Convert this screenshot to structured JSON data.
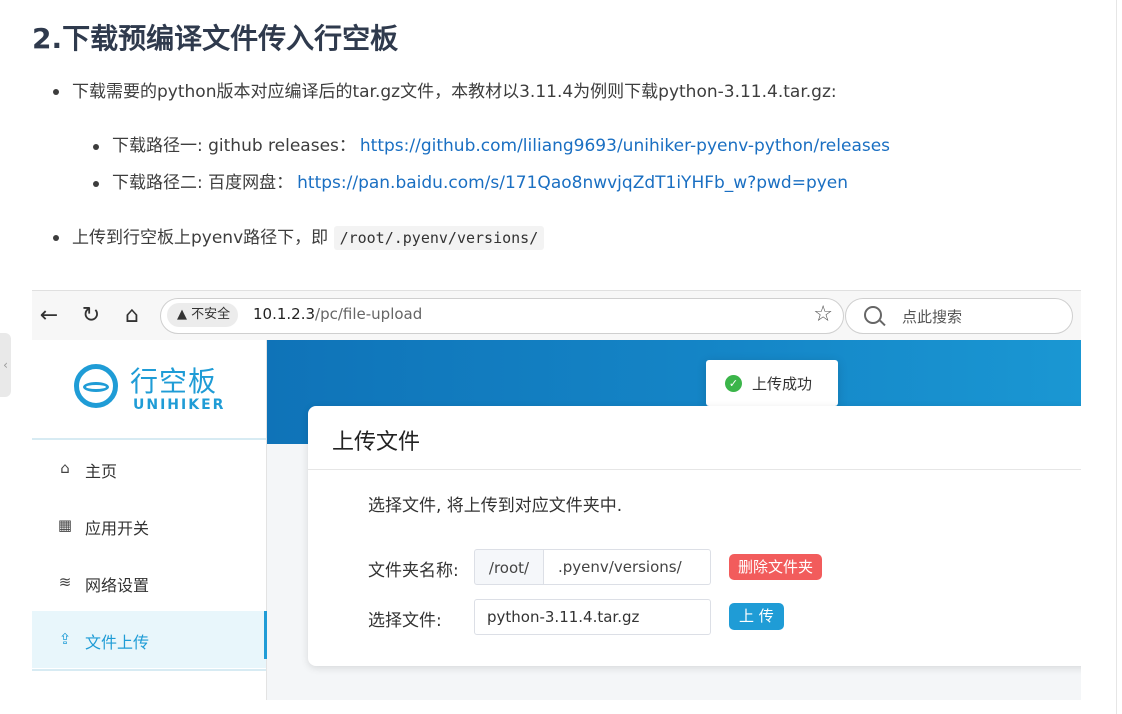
{
  "doc": {
    "title": "2.下载预编译文件传入行空板",
    "bullet1": "下载需要的python版本对应编译后的tar.gz文件，本教材以3.11.4为例则下载python-3.11.4.tar.gz:",
    "sub1_label": "下载路径一: github releases：",
    "sub1_link": "https://github.com/liliang9693/unihiker-pyenv-python/releases",
    "sub2_label": "下载路径二: 百度网盘：",
    "sub2_link": "https://pan.baidu.com/s/171Qao8nwvjqZdT1iYHFb_w?pwd=pyen",
    "bullet2": "上传到行空板上pyenv路径下，即",
    "bullet2_code": "/root/.pyenv/versions/",
    "side_toggle": "‹"
  },
  "browser": {
    "back": "←",
    "reload": "↻",
    "home": "⌂",
    "insecure_label": "▲ 不安全",
    "url_host": "10.1.2.3",
    "url_path": "/pc/file-upload",
    "star": "☆",
    "search_placeholder": "点此搜索"
  },
  "app": {
    "brand_cn": "行空板",
    "brand_en": "UNIHIKER",
    "menu": [
      {
        "label": "主页",
        "icon": "home-icon",
        "glyph": "⌂"
      },
      {
        "label": "应用开关",
        "icon": "grid-icon",
        "glyph": "▦"
      },
      {
        "label": "网络设置",
        "icon": "wifi-icon",
        "glyph": "≋"
      },
      {
        "label": "文件上传",
        "icon": "upload-icon",
        "glyph": "⇪"
      }
    ],
    "toast": {
      "text": "上传成功",
      "icon_glyph": "✓"
    },
    "card": {
      "title": "上传文件",
      "desc": "选择文件, 将上传到对应文件夹中.",
      "folder_label": "文件夹名称:",
      "folder_prefix": "/root/",
      "folder_value": ".pyenv/versions/",
      "delete_button": "删除文件夹",
      "file_label": "选择文件:",
      "file_value": "python-3.11.4.tar.gz",
      "upload_button": "上 传"
    }
  },
  "colors": {
    "accent": "#1f9cd6",
    "link": "#1a6fc2",
    "danger": "#f25c5c",
    "success": "#3bb54a",
    "hero": "#1587c8"
  }
}
